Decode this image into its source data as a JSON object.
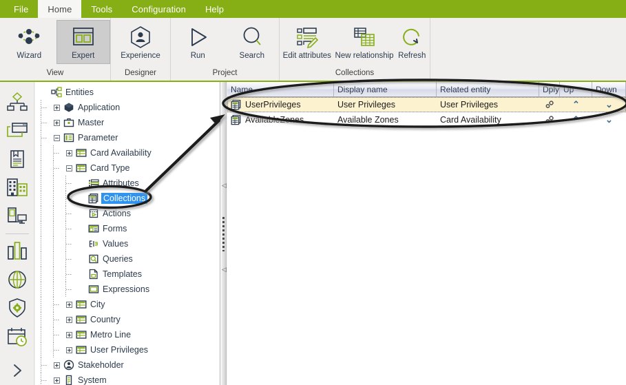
{
  "window": {
    "accent_green": "#86ae15",
    "ribbon_bg": "#f0efee"
  },
  "menubar": {
    "items": [
      {
        "label": "File",
        "active": false
      },
      {
        "label": "Home",
        "active": true
      },
      {
        "label": "Tools",
        "active": false
      },
      {
        "label": "Configuration",
        "active": false
      },
      {
        "label": "Help",
        "active": false
      }
    ]
  },
  "ribbon": {
    "groups": [
      {
        "label": "View",
        "buttons": [
          {
            "label": "Wizard",
            "icon": "wizard-nodes-icon",
            "selected": false
          },
          {
            "label": "Expert",
            "icon": "expert-layout-icon",
            "selected": true
          }
        ]
      },
      {
        "label": "Designer",
        "buttons": [
          {
            "label": "Experience",
            "icon": "experience-person-icon",
            "selected": false
          }
        ]
      },
      {
        "label": "Project",
        "buttons": [
          {
            "label": "Run",
            "icon": "run-play-icon",
            "selected": false
          },
          {
            "label": "Search",
            "icon": "search-magnifier-icon",
            "selected": false
          }
        ]
      },
      {
        "label": "Collections",
        "buttons": [
          {
            "label": "Edit attributes",
            "icon": "edit-attributes-icon",
            "selected": false
          },
          {
            "label": "New relationship",
            "icon": "new-relationship-icon",
            "selected": false
          },
          {
            "label": "Refresh",
            "icon": "refresh-circular-arrow-icon",
            "selected": false
          }
        ]
      }
    ]
  },
  "rail": {
    "icons": [
      {
        "name": "hierarchy-diagram-icon"
      },
      {
        "name": "window-stack-icon"
      },
      {
        "name": "document-bookmark-icon"
      },
      {
        "name": "buildings-icon"
      },
      {
        "name": "device-screen-icon"
      },
      {
        "name": "bar-chart-icon"
      },
      {
        "name": "globe-icon"
      },
      {
        "name": "shield-gear-icon"
      },
      {
        "name": "calendar-clock-icon"
      },
      {
        "name": "chevron-right-expand-icon"
      }
    ]
  },
  "tree": {
    "root": {
      "label": "Entities",
      "icon": "entities-icon"
    },
    "nodes": [
      {
        "label": "Entities",
        "depth": 0,
        "icon": "entities-icon",
        "expander": "none",
        "selected": false
      },
      {
        "label": "Application",
        "depth": 1,
        "icon": "application-icon",
        "expander": "plus",
        "selected": false
      },
      {
        "label": "Master",
        "depth": 1,
        "icon": "master-icon",
        "expander": "plus",
        "selected": false
      },
      {
        "label": "Parameter",
        "depth": 1,
        "icon": "parameter-icon",
        "expander": "minus",
        "selected": false
      },
      {
        "label": "Card Availability",
        "depth": 2,
        "icon": "table-icon",
        "expander": "plus",
        "selected": false
      },
      {
        "label": "Card Type",
        "depth": 2,
        "icon": "table-icon",
        "expander": "minus",
        "selected": false
      },
      {
        "label": "Attributes",
        "depth": 3,
        "icon": "attributes-icon",
        "expander": "none",
        "selected": false
      },
      {
        "label": "Collections",
        "depth": 3,
        "icon": "collections-icon",
        "expander": "none",
        "selected": true
      },
      {
        "label": "Actions",
        "depth": 3,
        "icon": "actions-icon",
        "expander": "none",
        "selected": false
      },
      {
        "label": "Forms",
        "depth": 3,
        "icon": "forms-icon",
        "expander": "none",
        "selected": false
      },
      {
        "label": "Values",
        "depth": 3,
        "icon": "values-icon",
        "expander": "none",
        "selected": false
      },
      {
        "label": "Queries",
        "depth": 3,
        "icon": "queries-icon",
        "expander": "none",
        "selected": false
      },
      {
        "label": "Templates",
        "depth": 3,
        "icon": "templates-icon",
        "expander": "none",
        "selected": false
      },
      {
        "label": "Expressions",
        "depth": 3,
        "icon": "expressions-icon",
        "expander": "none",
        "selected": false
      },
      {
        "label": "City",
        "depth": 2,
        "icon": "table-icon",
        "expander": "plus",
        "selected": false
      },
      {
        "label": "Country",
        "depth": 2,
        "icon": "table-icon",
        "expander": "plus",
        "selected": false
      },
      {
        "label": "Metro Line",
        "depth": 2,
        "icon": "table-icon",
        "expander": "plus",
        "selected": false
      },
      {
        "label": "User Privileges",
        "depth": 2,
        "icon": "table-icon",
        "expander": "plus",
        "selected": false
      },
      {
        "label": "Stakeholder",
        "depth": 1,
        "icon": "stakeholder-icon",
        "expander": "plus",
        "selected": false
      },
      {
        "label": "System",
        "depth": 1,
        "icon": "system-icon",
        "expander": "plus",
        "selected": false
      }
    ]
  },
  "grid": {
    "columns": [
      {
        "label": "Name",
        "width": 155
      },
      {
        "label": "Display name",
        "width": 149
      },
      {
        "label": "Related entity",
        "width": 149
      },
      {
        "label": "Dply",
        "width": 30
      },
      {
        "label": "Up",
        "width": 47
      },
      {
        "label": "Down",
        "width": 49
      }
    ],
    "rows": [
      {
        "name": "UserPrivileges",
        "display_name": "User Privileges",
        "related_entity": "User Privileges",
        "dply_icon": "deploy-gear-icon",
        "up_icon": "chevron-up-icon",
        "down_icon": "chevron-down-icon",
        "selected": true
      },
      {
        "name": "AvailableZones",
        "display_name": "Available Zones",
        "related_entity": "Card Availability",
        "dply_icon": "deploy-gear-icon",
        "up_icon": "chevron-up-icon",
        "down_icon": "chevron-down-icon",
        "selected": false
      }
    ]
  },
  "annotations": {
    "ellipse_tree_target": "Collections",
    "ellipse_grid_target": "collections-grid",
    "arrow": "arrow-from-collections-node-to-grid"
  }
}
